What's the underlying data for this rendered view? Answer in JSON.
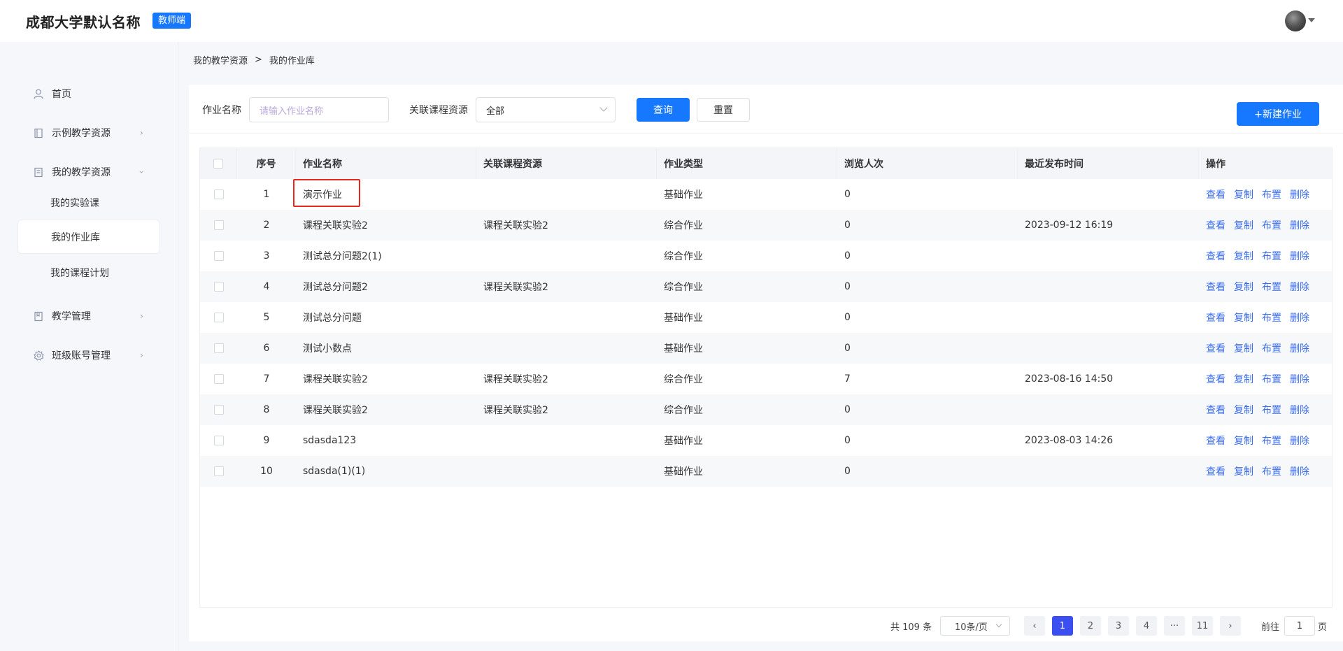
{
  "header": {
    "app_title": "成都大学默认名称",
    "role_badge": "教师端"
  },
  "sidebar": {
    "home": "首页",
    "sample_resources": "示例教学资源",
    "my_resources": "我的教学资源",
    "sub_items": [
      "我的实验课",
      "我的作业库",
      "我的课程计划"
    ],
    "teaching_mgmt": "教学管理",
    "class_accounts": "班级账号管理"
  },
  "breadcrumb": {
    "parent": "我的教学资源",
    "separator": ">",
    "current": "我的作业库"
  },
  "filters": {
    "name_label": "作业名称",
    "name_placeholder": "请输入作业名称",
    "course_label": "关联课程资源",
    "course_value": "全部",
    "query_button": "查询",
    "reset_button": "重置",
    "new_button": "+新建作业"
  },
  "table": {
    "headers": [
      "序号",
      "作业名称",
      "关联课程资源",
      "作业类型",
      "浏览人次",
      "最近发布时间",
      "操作"
    ],
    "ops": [
      "查看",
      "复制",
      "布置",
      "删除"
    ],
    "rows": [
      {
        "idx": "1",
        "name": "演示作业",
        "course": "",
        "type": "基础作业",
        "views": "0",
        "time": ""
      },
      {
        "idx": "2",
        "name": "课程关联实验2",
        "course": "课程关联实验2",
        "type": "综合作业",
        "views": "0",
        "time": "2023-09-12 16:19"
      },
      {
        "idx": "3",
        "name": "测试总分问题2(1)",
        "course": "",
        "type": "综合作业",
        "views": "0",
        "time": ""
      },
      {
        "idx": "4",
        "name": "测试总分问题2",
        "course": "课程关联实验2",
        "type": "综合作业",
        "views": "0",
        "time": ""
      },
      {
        "idx": "5",
        "name": "测试总分问题",
        "course": "",
        "type": "基础作业",
        "views": "0",
        "time": ""
      },
      {
        "idx": "6",
        "name": "测试小数点",
        "course": "",
        "type": "基础作业",
        "views": "0",
        "time": ""
      },
      {
        "idx": "7",
        "name": "课程关联实验2",
        "course": "课程关联实验2",
        "type": "综合作业",
        "views": "7",
        "time": "2023-08-16 14:50"
      },
      {
        "idx": "8",
        "name": "课程关联实验2",
        "course": "课程关联实验2",
        "type": "综合作业",
        "views": "0",
        "time": ""
      },
      {
        "idx": "9",
        "name": "sdasda123",
        "course": "",
        "type": "基础作业",
        "views": "0",
        "time": "2023-08-03 14:26"
      },
      {
        "idx": "10",
        "name": "sdasda(1)(1)",
        "course": "",
        "type": "基础作业",
        "views": "0",
        "time": ""
      }
    ]
  },
  "pagination": {
    "total": "共 109 条",
    "page_size": "10条/页",
    "prev": "‹",
    "pages": [
      "1",
      "2",
      "3",
      "4",
      "···",
      "11"
    ],
    "next": "›",
    "goto_label": "前往",
    "goto_value": "1",
    "goto_suffix": "页"
  }
}
